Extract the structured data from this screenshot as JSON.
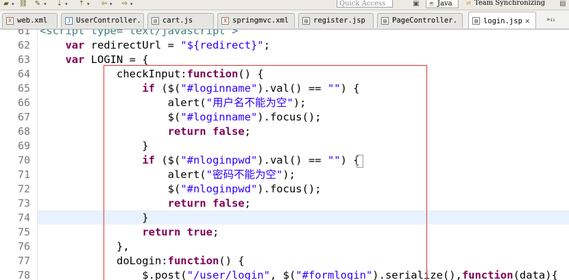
{
  "toolbar": {
    "icons": [
      "folder-open-icon",
      "link-icon",
      "pencil-icon",
      "annotation-icon",
      "back-arrow-icon",
      "forward-arrow-icon",
      "menu-arrow-icon"
    ],
    "quick_access_placeholder": "Quick Access",
    "perspectives": [
      {
        "label": "Java",
        "icon": "java-perspective-icon",
        "active": true
      },
      {
        "label": "Team Synchronizing",
        "icon": "team-sync-icon",
        "active": false
      }
    ]
  },
  "tabs": [
    {
      "label": "web.xml",
      "icon": "xml-file-icon",
      "active": false
    },
    {
      "label": "UserController.",
      "icon": "java-file-icon",
      "active": false
    },
    {
      "label": "cart.js",
      "icon": "js-file-icon",
      "active": false
    },
    {
      "label": "springmvc.xml",
      "icon": "xml-file-icon",
      "active": false
    },
    {
      "label": "register.jsp",
      "icon": "jsp-file-icon",
      "active": false
    },
    {
      "label": "PageController.",
      "icon": "java-file-icon",
      "active": false
    },
    {
      "label": "login.jsp",
      "icon": "jsp-file-icon",
      "active": true,
      "close": "✕"
    }
  ],
  "tab_overflow": "»₁₁",
  "editor": {
    "current_line": 74,
    "lines": [
      {
        "num": "61",
        "text": "<script type=\"text/javascript\">"
      },
      {
        "num": "62",
        "text": "    var redirectUrl = \"${redirect}\";"
      },
      {
        "num": "63",
        "text": "    var LOGIN = {"
      },
      {
        "num": "64",
        "text": "            checkInput:function() {"
      },
      {
        "num": "65",
        "text": "                if ($(\"#loginname\").val() == \"\") {"
      },
      {
        "num": "66",
        "text": "                    alert(\"用户名不能为空\");"
      },
      {
        "num": "67",
        "text": "                    $(\"#loginname\").focus();"
      },
      {
        "num": "68",
        "text": "                    return false;"
      },
      {
        "num": "69",
        "text": "                }"
      },
      {
        "num": "70",
        "text": "                if ($(\"#nloginpwd\").val() == \"\") {"
      },
      {
        "num": "71",
        "text": "                    alert(\"密码不能为空\");"
      },
      {
        "num": "72",
        "text": "                    $(\"#nloginpwd\").focus();"
      },
      {
        "num": "73",
        "text": "                    return false;"
      },
      {
        "num": "74",
        "text": "                }"
      },
      {
        "num": "75",
        "text": "                return true;"
      },
      {
        "num": "76",
        "text": "            },"
      },
      {
        "num": "77",
        "text": "            doLogin:function() {"
      },
      {
        "num": "78",
        "text": "                $.post(\"/user/login\", $(\"#formlogin\").serialize(),function(data){"
      }
    ]
  },
  "colors": {
    "keyword": "#7f0055",
    "string": "#2a00ff",
    "highlight_box": "#e0343a",
    "current_line": "#e8f2fe"
  }
}
